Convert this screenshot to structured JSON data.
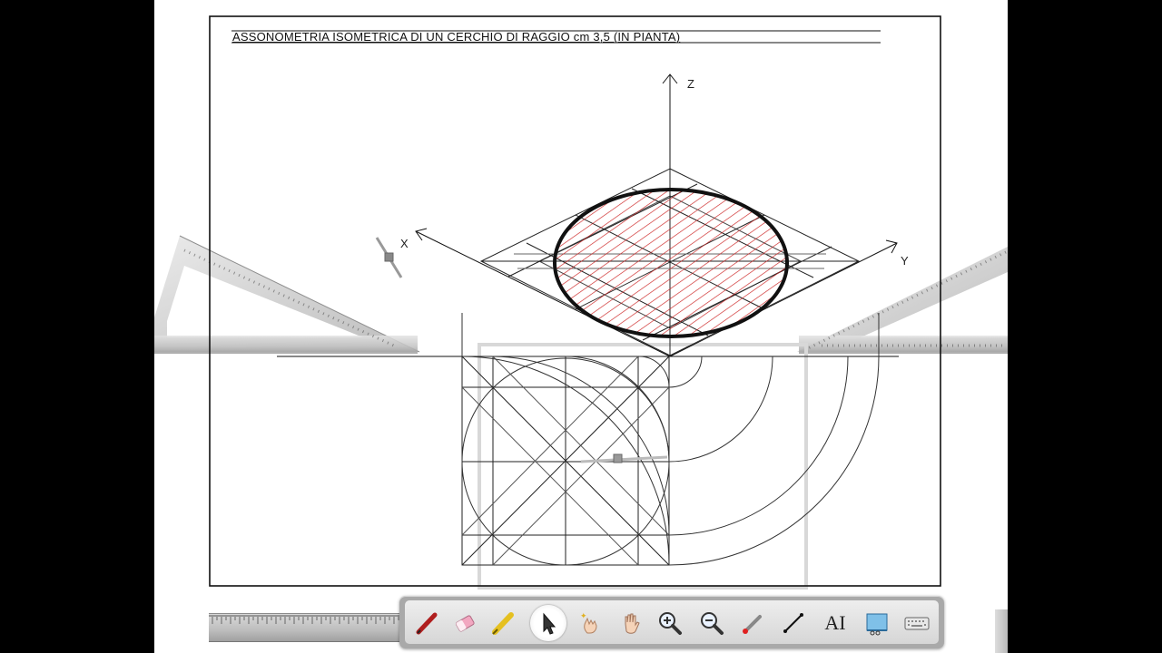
{
  "drawing": {
    "title": "ASSONOMETRIA ISOMETRICA DI UN CERCHIO DI RAGGIO cm 3,5 (IN PIANTA)",
    "axes": {
      "x": "X",
      "y": "Y",
      "z": "Z"
    }
  },
  "colors": {
    "hatch": "#cc2222",
    "ellipse_outline": "#111111",
    "toolbar": "#a9a9a9"
  },
  "toolbar": {
    "tools": [
      {
        "id": "pen",
        "icon": "red-pen-icon"
      },
      {
        "id": "eraser",
        "icon": "eraser-icon"
      },
      {
        "id": "highlighter",
        "icon": "highlighter-icon"
      },
      {
        "id": "select",
        "icon": "arrow-cursor-icon",
        "active": true
      },
      {
        "id": "magic",
        "icon": "magic-hand-icon"
      },
      {
        "id": "pan",
        "icon": "hand-icon"
      },
      {
        "id": "zoom-in",
        "icon": "zoom-in-icon"
      },
      {
        "id": "zoom-out",
        "icon": "zoom-out-icon"
      },
      {
        "id": "laser",
        "icon": "laser-pointer-icon"
      },
      {
        "id": "line",
        "icon": "line-icon"
      },
      {
        "id": "text",
        "icon": "text-tool-icon",
        "glyph": "AI"
      },
      {
        "id": "capture",
        "icon": "screen-capture-icon"
      },
      {
        "id": "keyboard",
        "icon": "keyboard-icon"
      }
    ]
  }
}
